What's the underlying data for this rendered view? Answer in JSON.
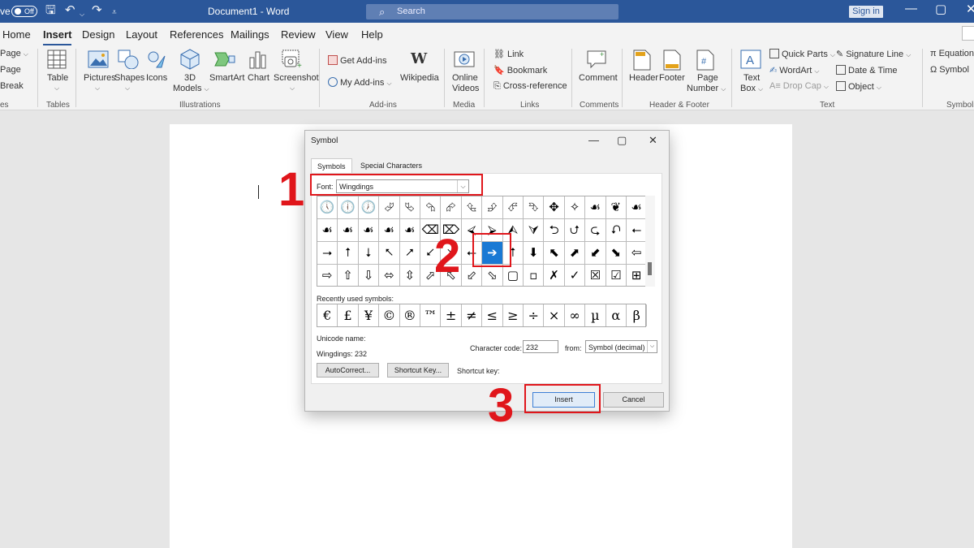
{
  "titlebar": {
    "autosave_label": "ve",
    "autosave_state": "Off",
    "doc_title": "Document1  -  Word",
    "search_placeholder": "Search",
    "signin": "Sign in"
  },
  "tabs": [
    "Home",
    "Insert",
    "Design",
    "Layout",
    "References",
    "Mailings",
    "Review",
    "View",
    "Help"
  ],
  "ribbon": {
    "pages": {
      "page": "Page",
      "blank_page": "Page",
      "page_break": "Break",
      "group": "es"
    },
    "tables": {
      "table": "Table",
      "group": "Tables"
    },
    "illustrations": {
      "pictures": "Pictures",
      "shapes": "Shapes",
      "icons": "Icons",
      "models_line1": "3D",
      "models_line2": "Models",
      "smartart": "SmartArt",
      "chart": "Chart",
      "screenshot": "Screenshot",
      "group": "Illustrations"
    },
    "addins": {
      "get": "Get Add-ins",
      "my": "My Add-ins",
      "wikipedia": "Wikipedia",
      "group": "Add-ins"
    },
    "media": {
      "online_line1": "Online",
      "online_line2": "Videos",
      "group": "Media"
    },
    "links": {
      "link": "Link",
      "bookmark": "Bookmark",
      "crossref": "Cross-reference",
      "group": "Links"
    },
    "comments": {
      "comment": "Comment",
      "group": "Comments"
    },
    "header_footer": {
      "header": "Header",
      "footer": "Footer",
      "page_line1": "Page",
      "page_line2": "Number",
      "group": "Header & Footer"
    },
    "text": {
      "textbox_line1": "Text",
      "textbox_line2": "Box",
      "quickparts": "Quick Parts",
      "wordart": "WordArt",
      "dropcap": "Drop Cap",
      "signature": "Signature Line",
      "datetime": "Date & Time",
      "object": "Object",
      "group": "Text"
    },
    "symbols": {
      "equation": "Equation",
      "symbol": "Symbol",
      "group": "Symbols"
    }
  },
  "dialog": {
    "title": "Symbol",
    "tabs": [
      "Symbols",
      "Special Characters"
    ],
    "font_label": "Font:",
    "font_value": "Wingdings",
    "grid": [
      [
        "🕔",
        "🕕",
        "🕖",
        "⮰",
        "⮱",
        "⮲",
        "⮳",
        "⮴",
        "⮵",
        "⮶",
        "⮷",
        "✥",
        "✧",
        "☙",
        "❦",
        "☙"
      ],
      [
        "☙",
        "☙",
        "☙",
        "☙",
        "☙",
        "⌫",
        "⌦",
        "⮘",
        "⮚",
        "⮙",
        "⮛",
        "⮌",
        "⮍",
        "⮎",
        "⮏",
        "⭠"
      ],
      [
        "⭢",
        "⭡",
        "⭣",
        "⭦",
        "⭧",
        "⭩",
        "⭨",
        "⭠",
        "➔",
        "⭡",
        "⬇",
        "⬉",
        "⬈",
        "⬋",
        "⬊",
        "⇦"
      ],
      [
        "⇨",
        "⇧",
        "⇩",
        "⬄",
        "⇳",
        "⬀",
        "⬁",
        "⬃",
        "⬂",
        "▢",
        "▫",
        "✗",
        "✓",
        "☒",
        "☑",
        "⊞"
      ]
    ],
    "selected_symbol": "➔",
    "recent_label": "Recently used symbols:",
    "recent": [
      "€",
      "£",
      "¥",
      "©",
      "®",
      "™",
      "±",
      "≠",
      "≤",
      "≥",
      "÷",
      "×",
      "∞",
      "µ",
      "α",
      "β"
    ],
    "unicode_name_label": "Unicode name:",
    "unicode_name_value": "Wingdings: 232",
    "char_code_label": "Character code:",
    "char_code_value": "232",
    "from_label": "from:",
    "from_value": "Symbol (decimal)",
    "autocorrect": "AutoCorrect...",
    "shortcut_key_button": "Shortcut Key...",
    "shortcut_key_label": "Shortcut key:",
    "insert": "Insert",
    "cancel": "Cancel"
  },
  "annotations": {
    "step1": "1",
    "step2": "2",
    "step3": "3"
  },
  "colors": {
    "word_blue": "#2b579a",
    "annotation_red": "#e0161b",
    "selection_blue": "#1979d4"
  }
}
